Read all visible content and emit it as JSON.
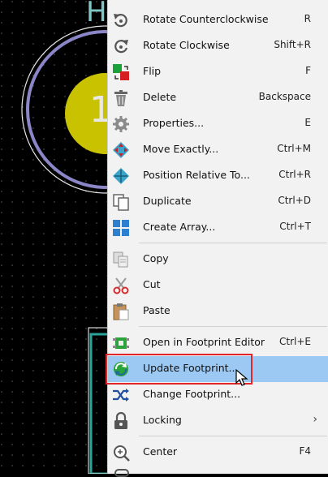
{
  "menu": {
    "items": [
      {
        "label": "Rotate Counterclockwise",
        "shortcut": "R",
        "icon": "rotate-ccw-icon"
      },
      {
        "label": "Rotate Clockwise",
        "shortcut": "Shift+R",
        "icon": "rotate-cw-icon"
      },
      {
        "label": "Flip",
        "shortcut": "F",
        "icon": "flip-icon"
      },
      {
        "label": "Delete",
        "shortcut": "Backspace",
        "icon": "trash-icon"
      },
      {
        "label": "Properties...",
        "shortcut": "E",
        "icon": "gear-icon"
      },
      {
        "label": "Move Exactly...",
        "shortcut": "Ctrl+M",
        "icon": "move-exactly-icon"
      },
      {
        "label": "Position Relative To...",
        "shortcut": "Ctrl+R",
        "icon": "position-relative-icon"
      },
      {
        "label": "Duplicate",
        "shortcut": "Ctrl+D",
        "icon": "duplicate-icon"
      },
      {
        "label": "Create Array...",
        "shortcut": "Ctrl+T",
        "icon": "array-icon"
      },
      {
        "label": "Copy",
        "shortcut": "",
        "icon": "copy-icon"
      },
      {
        "label": "Cut",
        "shortcut": "",
        "icon": "scissors-icon"
      },
      {
        "label": "Paste",
        "shortcut": "",
        "icon": "paste-icon"
      },
      {
        "label": "Open in Footprint Editor",
        "shortcut": "Ctrl+E",
        "icon": "footprint-editor-icon"
      },
      {
        "label": "Update Footprint...",
        "shortcut": "",
        "icon": "update-icon"
      },
      {
        "label": "Change Footprint...",
        "shortcut": "",
        "icon": "shuffle-icon"
      },
      {
        "label": "Locking",
        "shortcut": "›",
        "icon": "lock-icon"
      },
      {
        "label": "Center",
        "shortcut": "F4",
        "icon": "center-icon"
      }
    ]
  },
  "colors": {
    "highlight": "#9cc9f3",
    "menu_bg": "#f2f2f2",
    "canvas_bg": "#000000",
    "pad_yellow": "#c9c200",
    "silk_lilac": "#8a86c8"
  }
}
